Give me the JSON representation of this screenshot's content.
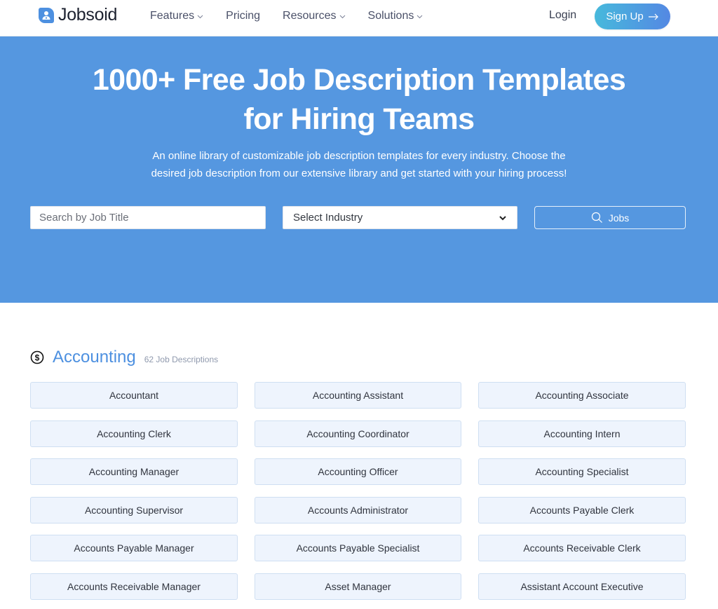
{
  "header": {
    "brand": "Jobsoid",
    "nav": [
      {
        "label": "Features",
        "has_dropdown": true
      },
      {
        "label": "Pricing",
        "has_dropdown": false
      },
      {
        "label": "Resources",
        "has_dropdown": true
      },
      {
        "label": "Solutions",
        "has_dropdown": true
      }
    ],
    "login_label": "Login",
    "signup_label": "Sign Up",
    "signup_icon": "arrow-right-icon"
  },
  "hero": {
    "title_line1": "1000+ Free Job Description Templates",
    "title_line2": "for Hiring Teams",
    "subtitle_line1": "An online library of customizable job description templates for every industry. Choose the",
    "subtitle_line2": "desired job description from our extensive library and get started with your hiring process!",
    "background_color": "#5597e0",
    "search": {
      "placeholder": "Search by Job Title",
      "value": ""
    },
    "industry_select": {
      "selected": "Select Industry"
    },
    "jobs_button": {
      "label": "Jobs",
      "icon": "search-icon"
    }
  },
  "category": {
    "icon": "dollar-circle-icon",
    "title": "Accounting",
    "count_label": "62 Job Descriptions",
    "accent_color": "#4d90e0",
    "jobs": [
      "Accountant",
      "Accounting Assistant",
      "Accounting Associate",
      "Accounting Clerk",
      "Accounting Coordinator",
      "Accounting Intern",
      "Accounting Manager",
      "Accounting Officer",
      "Accounting Specialist",
      "Accounting Supervisor",
      "Accounts Administrator",
      "Accounts Payable Clerk",
      "Accounts Payable Manager",
      "Accounts Payable Specialist",
      "Accounts Receivable Clerk",
      "Accounts Receivable Manager",
      "Asset Manager",
      "Assistant Account Executive"
    ]
  }
}
